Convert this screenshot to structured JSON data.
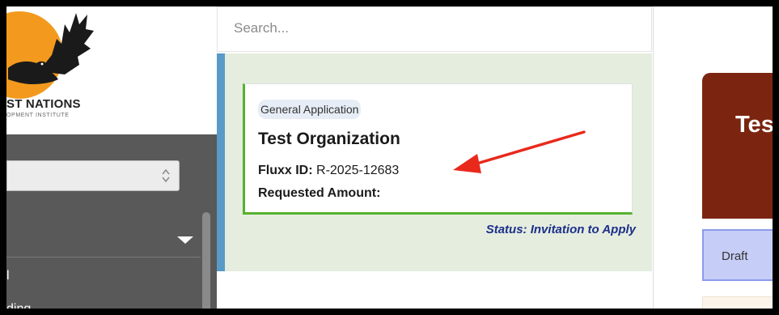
{
  "logo": {
    "title": "ST NATIONS",
    "subtitle": "OPMENT INSTITUTE",
    "sun_color": "#f39a1e"
  },
  "sidebar": {
    "select_value": "",
    "items": [
      {
        "label": "l"
      },
      {
        "label": "ding"
      }
    ],
    "background": "#595959"
  },
  "search": {
    "placeholder": "Search..."
  },
  "application_card": {
    "type_label": "General Application",
    "organization": "Test Organization",
    "fluxx_id_label": "Fluxx ID:",
    "fluxx_id_value": "R-2025-12683",
    "requested_amount_label": "Requested Amount:",
    "requested_amount_value": "",
    "status": "Status: Invitation to Apply",
    "accent_color": "#55b22f"
  },
  "detail_panel": {
    "title": "Tes",
    "header_color": "#7b2510",
    "tabs": [
      {
        "label": "Draft"
      }
    ]
  }
}
